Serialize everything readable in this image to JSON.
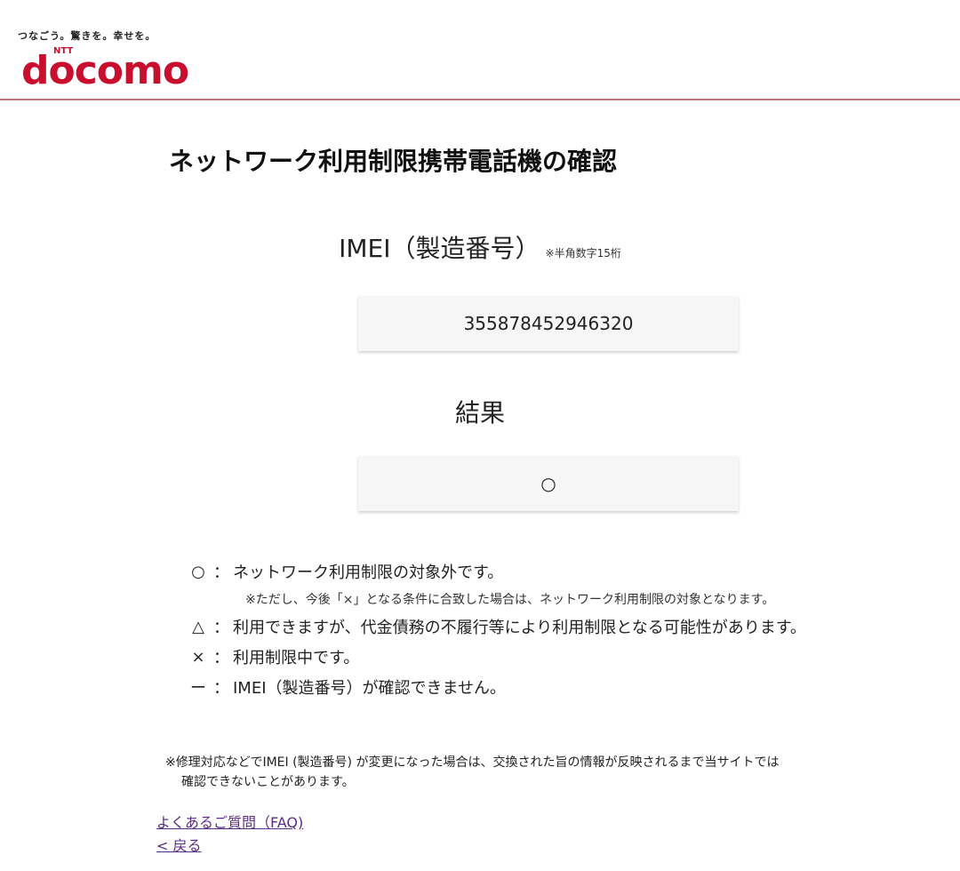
{
  "header": {
    "tagline": "つなごう。驚きを。幸せを。",
    "logo_text": "docomo",
    "logo_sub": "NTT",
    "accent_color": "#c8102e"
  },
  "page_title": "ネットワーク利用制限携帯電話機の確認",
  "imei": {
    "heading": "IMEI（製造番号）",
    "note": "※半角数字15桁",
    "value": "355878452946320"
  },
  "result": {
    "heading": "結果",
    "value": "○"
  },
  "legend": {
    "items": [
      {
        "symbol": "○",
        "colon": "：",
        "text": "ネットワーク利用制限の対象外です。"
      },
      {
        "symbol": "△",
        "colon": "：",
        "text": "利用できますが、代金債務の不履行等により利用制限となる可能性があります。"
      },
      {
        "symbol": "×",
        "colon": "：",
        "text": "利用制限中です。"
      },
      {
        "symbol": "ー",
        "colon": "：",
        "text": "IMEI（製造番号）が確認できません。"
      }
    ],
    "sub_note": "※ただし、今後「×」となる条件に合致した場合は、ネットワーク利用制限の対象となります。"
  },
  "footnote": {
    "line1": "※修理対応などでIMEI (製造番号) が変更になった場合は、交換された旨の情報が反映されるまで当サイトでは",
    "line2": "確認できないことがあります。"
  },
  "links": {
    "faq": "よくあるご質問（FAQ)",
    "back": "< 戻る"
  }
}
